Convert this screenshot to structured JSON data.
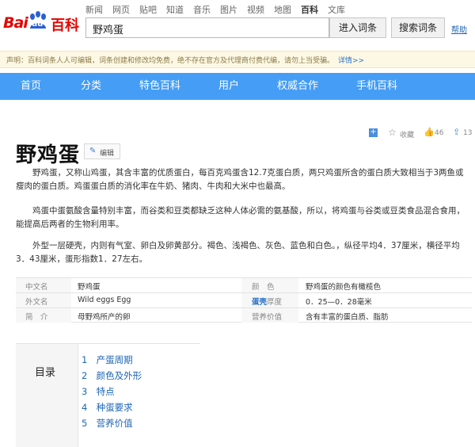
{
  "logo": {
    "bai": "Bai",
    "du": "du",
    "baike": "百科"
  },
  "nav_links": [
    "新闻",
    "网页",
    "贴吧",
    "知道",
    "音乐",
    "图片",
    "视频",
    "地图",
    "百科",
    "文库"
  ],
  "nav_active": "百科",
  "search": {
    "value": "野鸡蛋",
    "enter_label": "进入词条",
    "search_label": "搜索词条",
    "help": "帮助"
  },
  "notice": {
    "text": "声明：百科词条人人可编辑，词条创建和修改均免费，绝不存在官方及代理商付费代编，请勿上当受骗。",
    "more": "详情>>"
  },
  "bluenav": [
    "首页",
    "分类",
    "特色百科",
    "用户",
    "权威合作",
    "手机百科"
  ],
  "article": {
    "title": "野鸡蛋",
    "edit_label": "编辑",
    "edit_icon": "pencil-icon",
    "favorite_label": "收藏",
    "like_count": "46",
    "share_count": "13",
    "paragraphs": [
      "野鸡蛋，又称山鸡蛋，其含丰富的优质蛋白，每百克鸡蛋含12.7克蛋白质，两只鸡蛋所含的蛋白质大致相当于3两鱼或瘦肉的蛋白质。鸡蛋蛋白质的消化率在牛奶、猪肉、牛肉和大米中也最高。",
      "鸡蛋中蛋氨酸含量特别丰富，而谷类和豆类都缺乏这种人体必需的氨基酸，所以，将鸡蛋与谷类或豆类食品混合食用，能提高后两者的生物利用率。",
      "外型一层硬壳，内则有气室、卵白及卵黄部分。褐色、浅褐色、灰色、蓝色和白色。，纵径平均4．37厘米，横径平均3．43厘米，蛋形指数1．27左右。"
    ]
  },
  "info": [
    {
      "k1": "中文名",
      "v1": "野鸡蛋",
      "k2": "颜　色",
      "v2": "野鸡蛋的颜色有橄榄色"
    },
    {
      "k1": "外文名",
      "v1": "Wild eggs Egg",
      "k2link": "蛋壳",
      "k2": "厚度",
      "v2": "0．25—0．28毫米"
    },
    {
      "k1": "简　介",
      "v1": "母野鸡所产的卵",
      "k2": "营养价值",
      "v2": "含有丰富的蛋白质、脂肪"
    }
  ],
  "toc": {
    "label": "目录",
    "items": [
      {
        "num": "1",
        "text": "产蛋周期"
      },
      {
        "num": "2",
        "text": "颜色及外形"
      },
      {
        "num": "3",
        "text": "特点"
      },
      {
        "num": "4",
        "text": "种蛋要求"
      },
      {
        "num": "5",
        "text": "营养价值"
      }
    ]
  },
  "colors": {
    "brand_red": "#e10602",
    "nav_blue": "#459df5",
    "link_blue": "#1e66b8"
  }
}
